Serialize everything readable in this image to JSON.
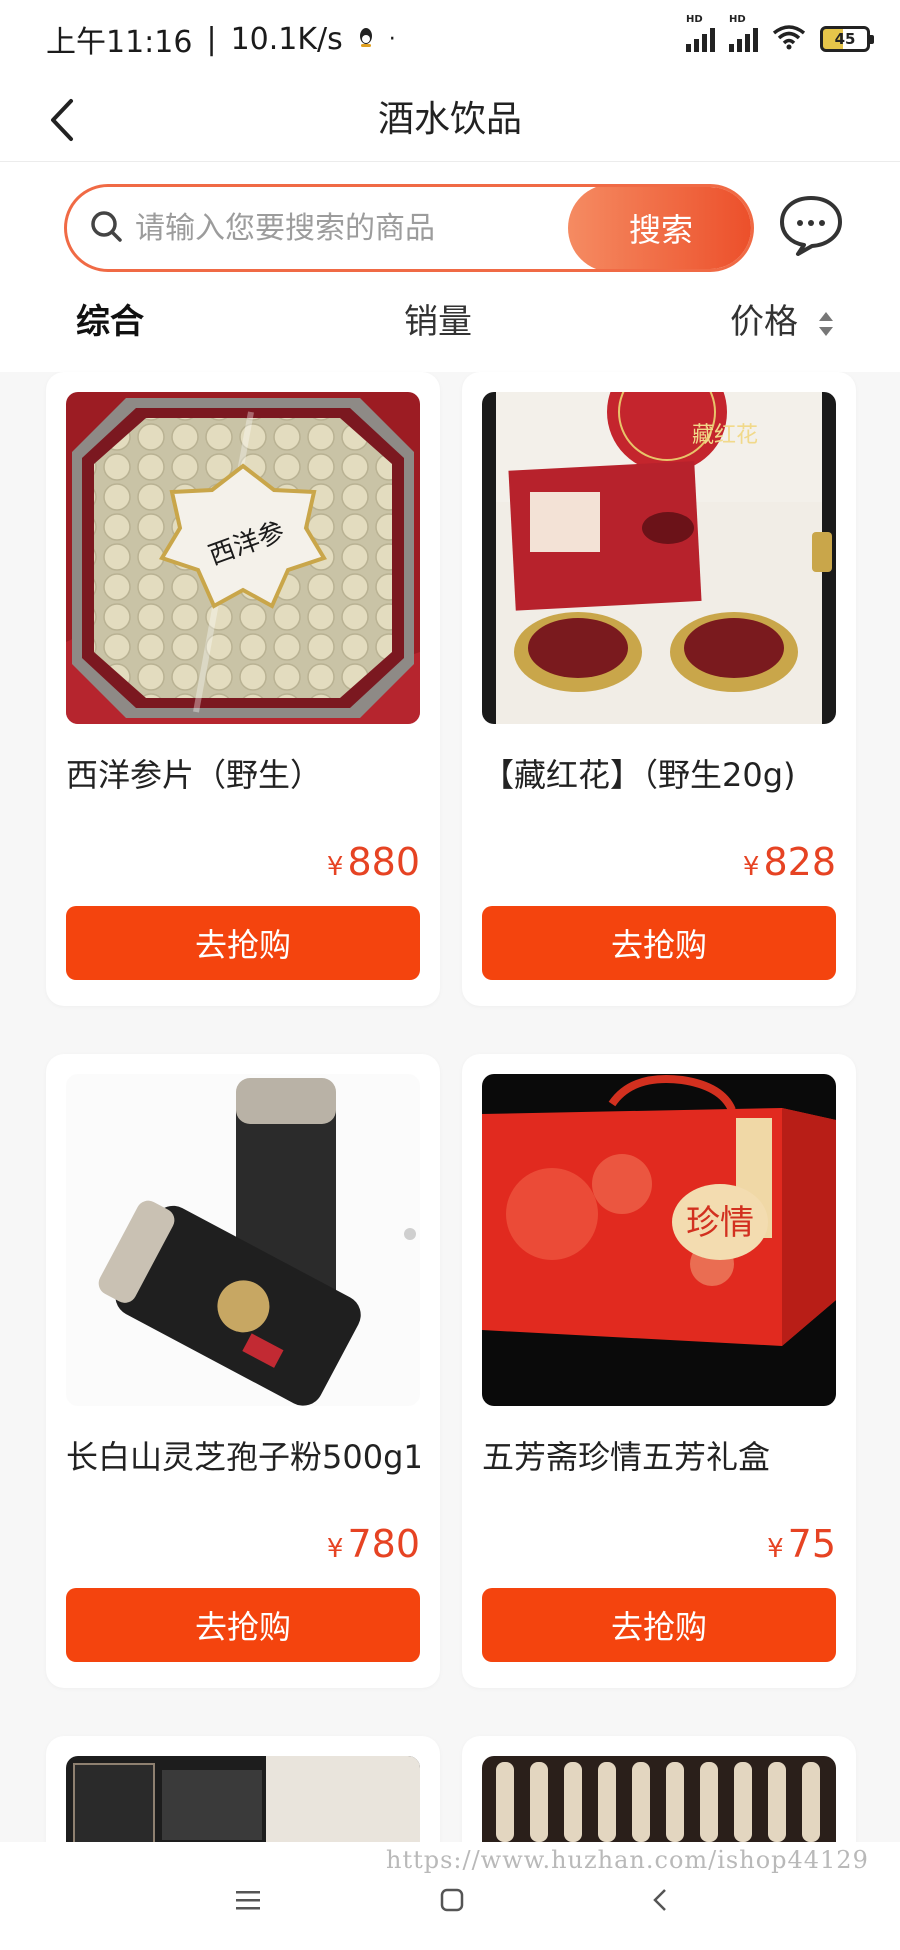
{
  "status_bar": {
    "time": "上午11:16",
    "speed": "10.1K/s",
    "dot": "·",
    "hd1": "HD",
    "hd2": "HD",
    "battery": "45"
  },
  "nav": {
    "title": "酒水饮品"
  },
  "search": {
    "placeholder": "请输入您要搜索的商品",
    "button_label": "搜索"
  },
  "sort_tabs": {
    "comprehensive": "综合",
    "sales": "销量",
    "price": "价格"
  },
  "products": [
    {
      "name": "西洋参片（野生）",
      "currency": "¥",
      "price": "880",
      "button": "去抢购"
    },
    {
      "name": "【藏红花】（野生20g)",
      "currency": "¥",
      "price": "828",
      "button": "去抢购"
    },
    {
      "name": "长白山灵芝孢子粉500g1",
      "currency": "¥",
      "price": "780",
      "button": "去抢购"
    },
    {
      "name": "五芳斋珍情五芳礼盒",
      "currency": "¥",
      "price": "75",
      "button": "去抢购"
    }
  ],
  "images": {
    "ginseng_label": "西洋参",
    "saffron_label": "藏红花",
    "zongzi_label": "珍情"
  },
  "watermark": "https://www.huzhan.com/ishop44129",
  "colors": {
    "accent": "#f4440e",
    "price": "#e64323",
    "search_border": "#f06a45"
  }
}
